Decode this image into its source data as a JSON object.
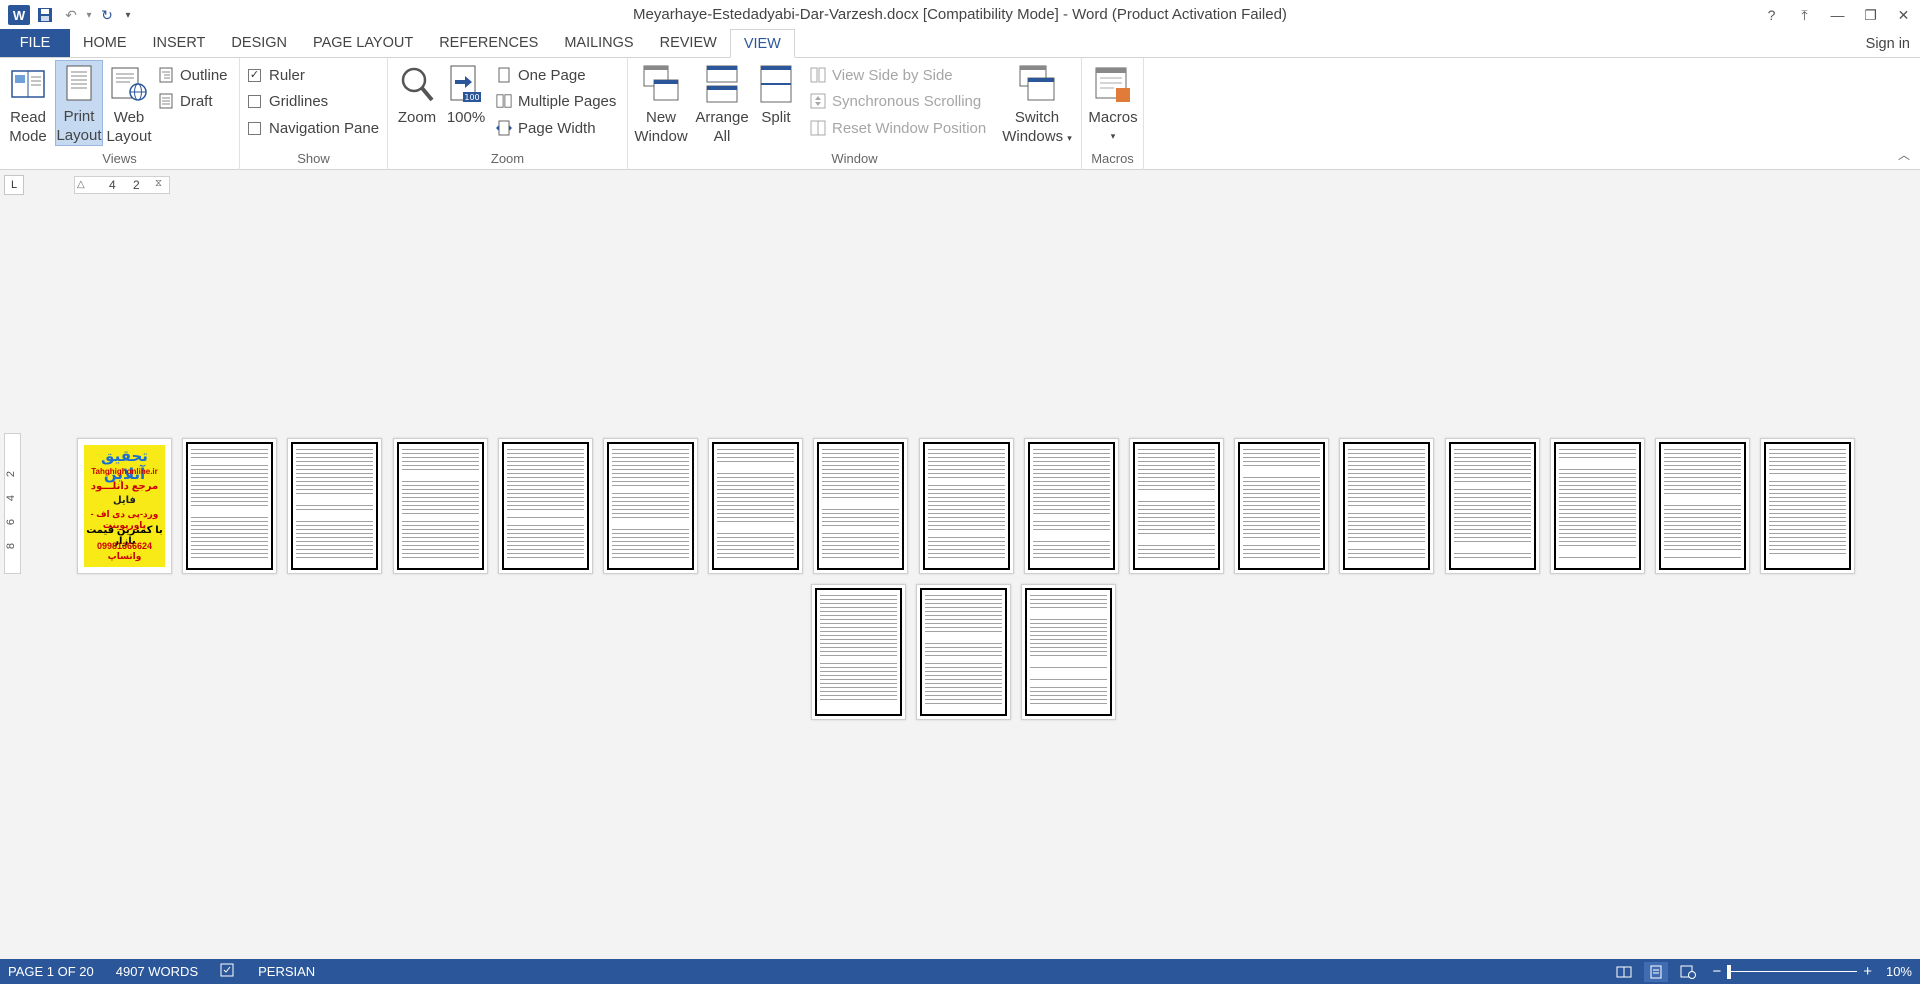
{
  "window": {
    "title": "Meyarhaye-Estedadyabi-Dar-Varzesh.docx [Compatibility Mode] - Word (Product Activation Failed)",
    "help": "?",
    "restore_ribbon": "⤒",
    "minimize": "—",
    "restore": "❐",
    "close": "✕"
  },
  "qat": {
    "app_icon": "W",
    "save": "💾",
    "undo": "↶",
    "undo_dd": "▾",
    "redo": "↻",
    "customize": "▾"
  },
  "tabs": [
    "FILE",
    "HOME",
    "INSERT",
    "DESIGN",
    "PAGE LAYOUT",
    "REFERENCES",
    "MAILINGS",
    "REVIEW",
    "VIEW"
  ],
  "active_tab": "VIEW",
  "signin": "Sign in",
  "ribbon": {
    "views": {
      "label": "Views",
      "read_mode": [
        "Read",
        "Mode"
      ],
      "print_layout": [
        "Print",
        "Layout"
      ],
      "web_layout": [
        "Web",
        "Layout"
      ],
      "outline": "Outline",
      "draft": "Draft"
    },
    "show": {
      "label": "Show",
      "ruler": "Ruler",
      "ruler_checked": true,
      "gridlines": "Gridlines",
      "gridlines_checked": false,
      "navigation_pane": "Navigation Pane",
      "navigation_pane_checked": false
    },
    "zoom": {
      "label": "Zoom",
      "zoom": "Zoom",
      "hundred": "100%",
      "one_page": "One Page",
      "multiple_pages": "Multiple Pages",
      "page_width": "Page Width"
    },
    "window": {
      "label": "Window",
      "new_window": [
        "New",
        "Window"
      ],
      "arrange_all": [
        "Arrange",
        "All"
      ],
      "split": "Split",
      "view_side_by_side": "View Side by Side",
      "synchronous_scrolling": "Synchronous Scrolling",
      "reset_window_position": "Reset Window Position",
      "switch_windows": [
        "Switch",
        "Windows"
      ]
    },
    "macros": {
      "label": "Macros",
      "macros": "Macros"
    }
  },
  "ruler": {
    "tab_selector": "L",
    "h_ticks": [
      "4",
      "2"
    ],
    "v_ticks": [
      "2",
      "4",
      "6",
      "8"
    ]
  },
  "document": {
    "cover_lines": [
      "تحقیق آنلاین",
      "Tahghighonline.ir",
      "مرجع دانلـــود",
      "فایل",
      "ورد-پی دی اف - پاورپوینت",
      "با کمترین قیمت بازار",
      "09981366624 واتساپ"
    ]
  },
  "status": {
    "page": "PAGE 1 OF 20",
    "words": "4907 WORDS",
    "proofing_icon": "📖",
    "language": "PERSIAN",
    "zoom_minus": "−",
    "zoom_plus": "+",
    "zoom_level": "10%",
    "zoom_level_value": 10
  }
}
